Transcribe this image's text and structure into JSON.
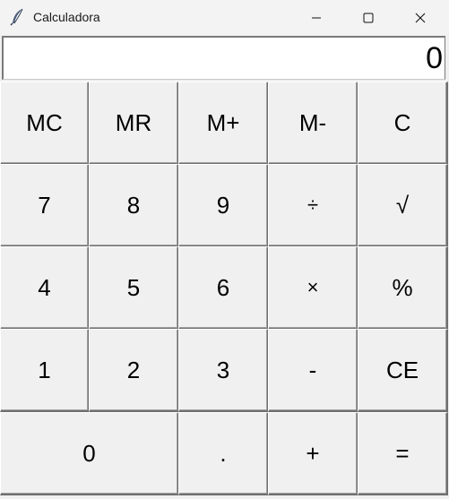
{
  "window": {
    "title": "Calculadora",
    "icon": "feather-icon"
  },
  "display": {
    "value": "0"
  },
  "keys": [
    [
      "MC",
      "MR",
      "M+",
      "M-",
      "C"
    ],
    [
      "7",
      "8",
      "9",
      "÷",
      "√"
    ],
    [
      "4",
      "5",
      "6",
      "×",
      "%"
    ],
    [
      "1",
      "2",
      "3",
      "-",
      "CE"
    ],
    [
      "0",
      ".",
      "+",
      "="
    ]
  ]
}
